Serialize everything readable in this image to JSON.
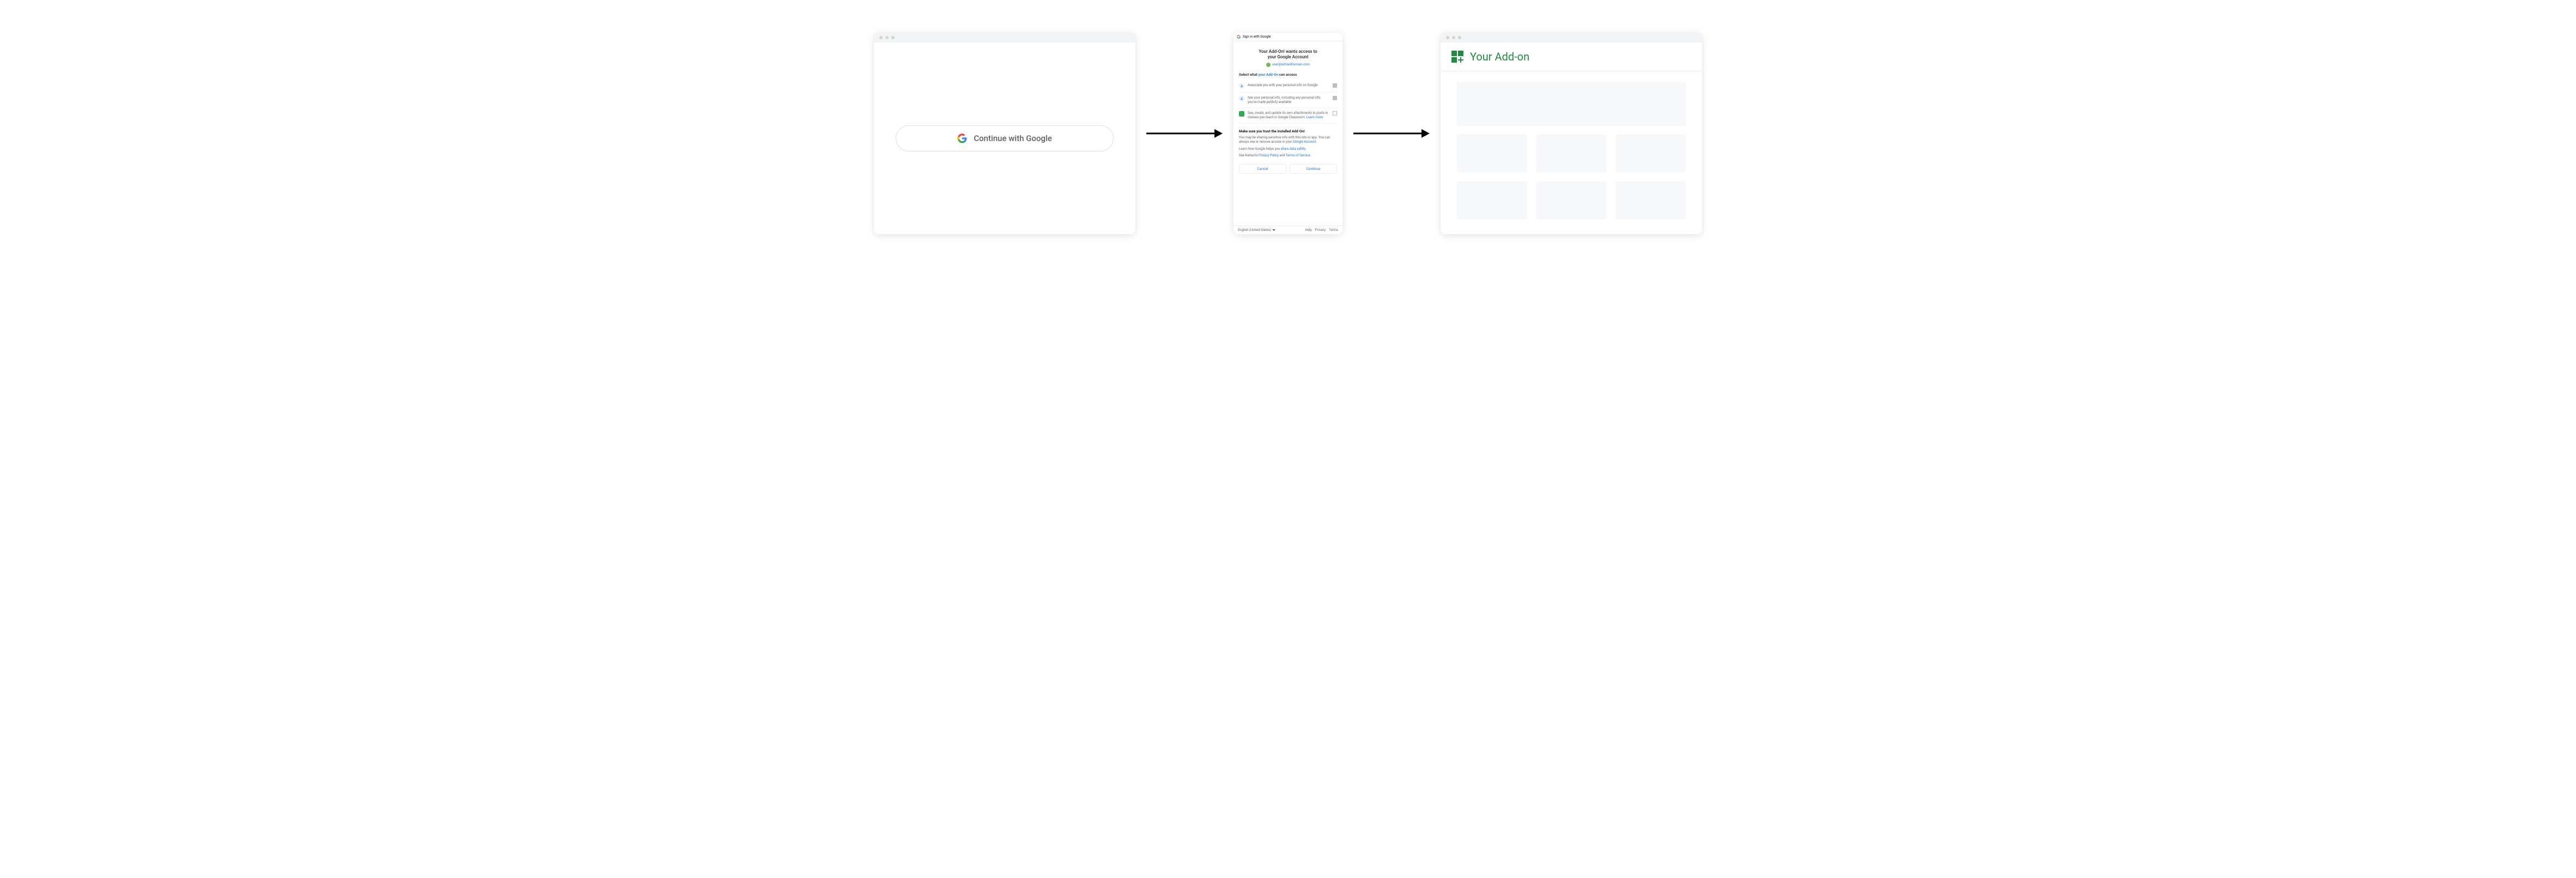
{
  "left": {
    "button_label": "Continue with Google"
  },
  "consent": {
    "header": "Sign in with Google",
    "title_line1": "Your Add-On! wants access to",
    "title_line2": "your Google Account",
    "user_email": "user@schoolDomain.com",
    "select_prefix": "Select what ",
    "select_link": "your Add-On",
    "select_suffix": " can access",
    "scopes": [
      {
        "text": "Associate you with your personal info on Google",
        "checked": true,
        "icon": "person"
      },
      {
        "text": "See your personal info, including any personal info you've made publicly available",
        "checked": true,
        "icon": "person"
      },
      {
        "text_prefix": "See, create, and update its own attachments to posts in classes you teach in Google Classroom. ",
        "link": "Learn more",
        "checked": false,
        "icon": "classroom"
      }
    ],
    "trust_title": "Make sure you trust the installed Add-On!",
    "trust_body_prefix": "You may be sharing sensitive info with this site or app. You can always see or remove access in your ",
    "trust_body_link": "Google Account",
    "trust_body_suffix": ".",
    "share_prefix": "Learn how Google helps you ",
    "share_link": "share data safely",
    "share_suffix": ".",
    "policy_prefix": "See Kahoot's ",
    "policy_link1": "Privacy Policy",
    "policy_and": " and ",
    "policy_link2": "Terms of Service",
    "policy_suffix": ".",
    "btn_cancel": "Cancel",
    "btn_continue": "Continue",
    "footer": {
      "language": "English (United States)",
      "help": "Help",
      "privacy": "Privacy",
      "terms": "Terms"
    }
  },
  "right": {
    "title": "Your Add-on"
  }
}
